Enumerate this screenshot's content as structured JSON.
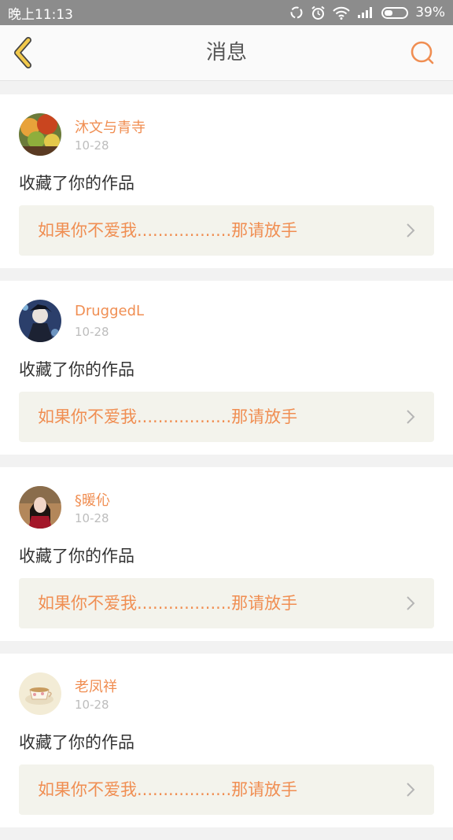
{
  "status_bar": {
    "time": "晚上11:13",
    "battery": "39%",
    "battery_level": 0.39,
    "icons": [
      "sync-icon",
      "alarm-icon",
      "wifi-icon",
      "signal-icon",
      "battery-icon"
    ]
  },
  "header": {
    "title": "消息",
    "back_icon": "back-chevron-icon",
    "search_icon": "search-icon"
  },
  "colors": {
    "accent": "#f08e52",
    "back_arrow": "#f2c94c",
    "status_bar": "#8c8c8c",
    "work_bg": "#f3f3ec"
  },
  "messages": [
    {
      "username": "沐文与青寺",
      "date": "10-28",
      "action": "收藏了你的作品",
      "work_title": "如果你不爱我..................那请放手",
      "avatar": "autumn-leaves-avatar"
    },
    {
      "username": "DruggedL",
      "date": "10-28",
      "action": "收藏了你的作品",
      "work_title": "如果你不爱我..................那请放手",
      "avatar": "anime-character-avatar"
    },
    {
      "username": "§暖伈",
      "date": "10-28",
      "action": "收藏了你的作品",
      "work_title": "如果你不爱我..................那请放手",
      "avatar": "woman-portrait-avatar"
    },
    {
      "username": "老凤祥",
      "date": "10-28",
      "action": "收藏了你的作品",
      "work_title": "如果你不爱我..................那请放手",
      "avatar": "teacup-avatar"
    }
  ]
}
